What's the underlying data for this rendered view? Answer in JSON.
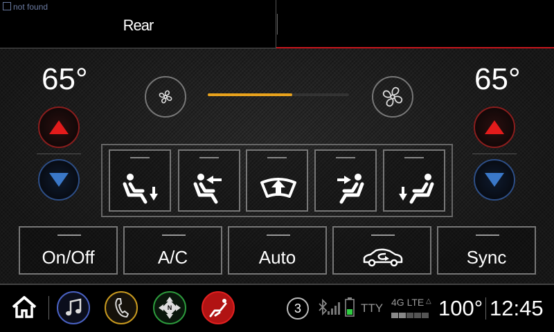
{
  "header": {
    "tab_label": "Rear",
    "broken_image_alt": "not found"
  },
  "climate": {
    "left_temp": "65°",
    "right_temp": "65°",
    "fan_level": 0.6
  },
  "modes": [
    {
      "name": "mode-face-down-button"
    },
    {
      "name": "mode-face-button"
    },
    {
      "name": "mode-defrost-button"
    },
    {
      "name": "mode-bilevel-button"
    },
    {
      "name": "mode-floor-button"
    }
  ],
  "buttons": {
    "on_off": "On/Off",
    "ac": "A/C",
    "auto": "Auto",
    "sync": "Sync"
  },
  "status_bar": {
    "notification_count": "3",
    "tty": "TTY",
    "network": "4G LTE",
    "outside_temp": "100°",
    "time": "12:45"
  },
  "colors": {
    "accent_red": "#c8161d",
    "up_arrow": "#e31b1b",
    "down_arrow": "#3a78c9",
    "fan_fill": "#e8a21c",
    "battery": "#2ecc40"
  },
  "icons": [
    "home-icon",
    "music-icon",
    "phone-icon",
    "navigation-icon",
    "climate-icon",
    "bluetooth-icon",
    "signal-icon",
    "battery-icon"
  ]
}
